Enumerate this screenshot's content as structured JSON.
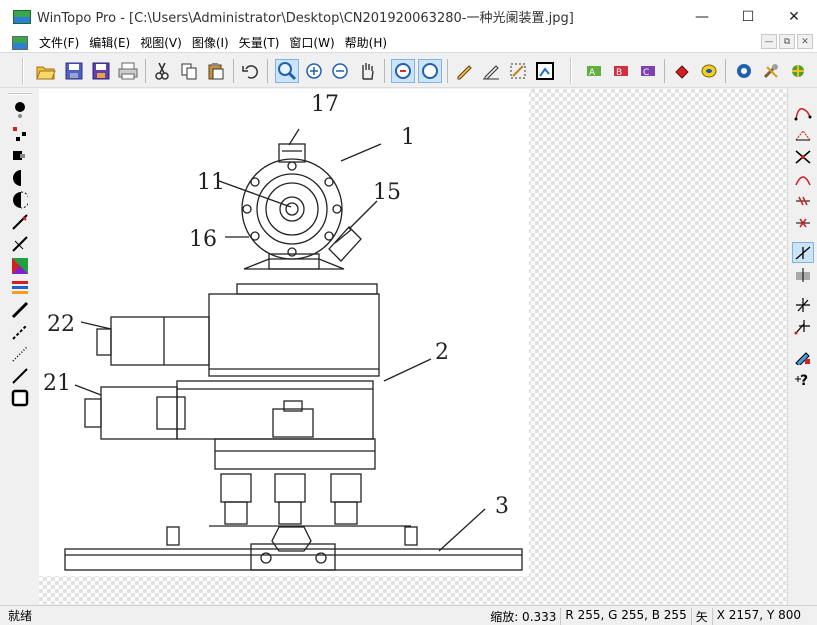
{
  "window": {
    "title": "WinTopo Pro - [C:\\Users\\Administrator\\Desktop\\CN201920063280-一种光阑装置.jpg]",
    "controls": {
      "minimize": "—",
      "maximize": "☐",
      "close": "✕"
    }
  },
  "menu": {
    "items": [
      "文件(F)",
      "编辑(E)",
      "视图(V)",
      "图像(I)",
      "矢量(T)",
      "窗口(W)",
      "帮助(H)"
    ],
    "mdi_controls": [
      "—",
      "⧉",
      "✕"
    ]
  },
  "toolbar": {
    "icons": [
      "open-icon",
      "save-icon",
      "save-as-icon",
      "print-icon",
      "cut-icon",
      "copy-icon",
      "paste-icon",
      "undo-icon",
      "zoom-icon",
      "zoom-in-icon",
      "zoom-out-icon",
      "pan-hand-icon",
      "view-image-icon",
      "view-vector-icon",
      "pencil-icon",
      "pen-icon",
      "crop-select-icon",
      "crop-icon",
      "vectorize-1-icon",
      "vectorize-2-icon",
      "vectorize-3-icon",
      "fill-icon",
      "thin-icon",
      "settings-icon",
      "tools-icon"
    ]
  },
  "drawing": {
    "labels": [
      "17",
      "1",
      "11",
      "15",
      "16",
      "22",
      "2",
      "21",
      "3"
    ]
  },
  "colors": {
    "accent": "#cce4f7",
    "accent_border": "#7fb4e0",
    "canvas_check": "#e2e2e2"
  },
  "status": {
    "ready": "就绪",
    "zoom": "缩放: 0.333",
    "rgb": "R 255, G 255, B 255",
    "mode": "矢",
    "coords": "X 2157, Y 800"
  }
}
